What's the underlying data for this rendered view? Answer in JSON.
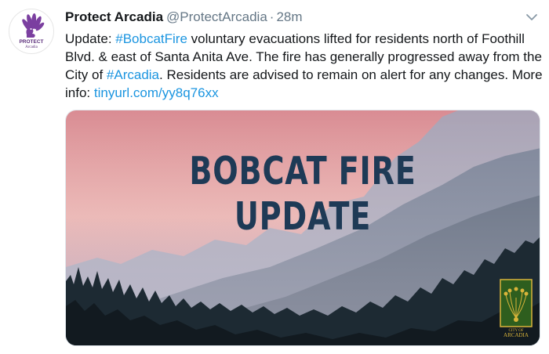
{
  "tweet": {
    "author_name": "Protect Arcadia",
    "author_handle": "@ProtectArcadia",
    "separator": "·",
    "timestamp": "28m",
    "avatar_text_top": "PROTECT",
    "avatar_text_bottom": "Arcadia",
    "text": {
      "part1": "Update: ",
      "hashtag1": "#BobcatFire",
      "part2": " voluntary evacuations lifted for residents north of Foothill Blvd. & east of Santa Anita Ave. The fire has generally progressed away from the City of ",
      "hashtag2": "#Arcadia",
      "part3": ". Residents are advised to remain on alert for any changes. More info: ",
      "link": "tinyurl.com/yy8q76xx"
    },
    "media": {
      "headline_line1": "BOBCAT FIRE",
      "headline_line2": "UPDATE",
      "seal_text_top": "CITY OF",
      "seal_text_bottom": "ARCADIA"
    }
  },
  "colors": {
    "link": "#1b95e0",
    "avatar_purple": "#7b3fa0",
    "headline": "#1e3a56",
    "seal_green": "#2e5e1e",
    "seal_gold": "#d9b43a"
  },
  "icons": {
    "caret": "chevron-down-icon",
    "avatar": "peacock-logo-icon"
  }
}
